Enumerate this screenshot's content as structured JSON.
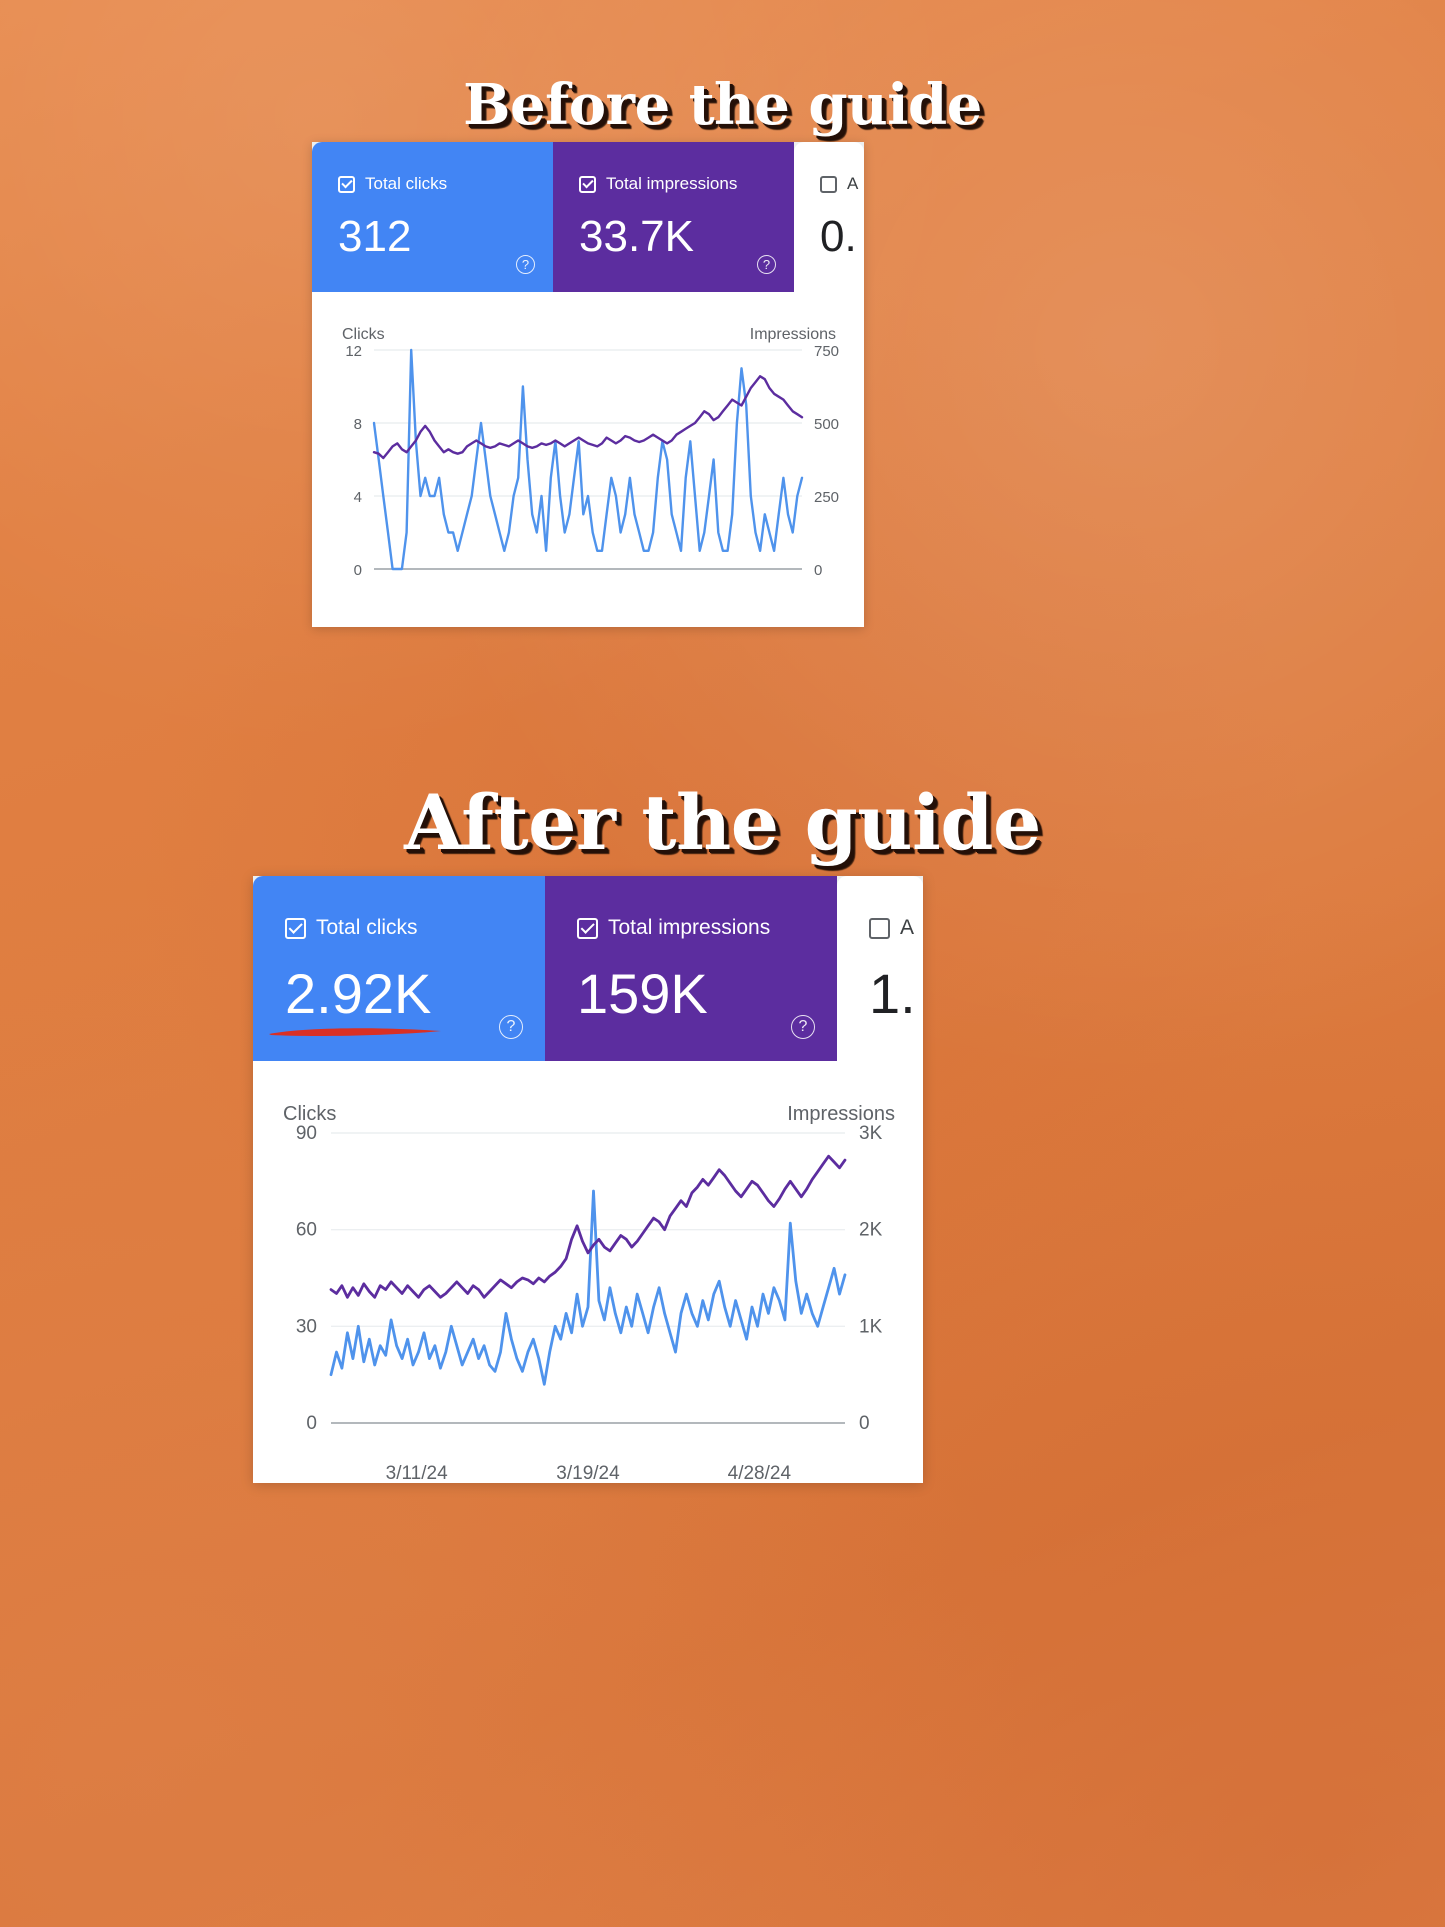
{
  "theme": {
    "background_color": "#e07f42",
    "clicks_color": "#4285f4",
    "impressions_color": "#5c2d9f",
    "clicks_line_color": "#4f93ec",
    "impressions_line_color": "#5c2d9f",
    "annotation_color": "#d93025",
    "title_color": "#ffffff",
    "title_shadow_color": "#241008"
  },
  "sections": {
    "before": {
      "title": "Before the guide",
      "cards": [
        {
          "label": "Total clicks",
          "value": "312",
          "checkbox": "checked",
          "checkbox_icon": "checkbox-checked-icon",
          "help_icon": "help-circle-icon",
          "help_glyph": "?",
          "color": "#4285f4"
        },
        {
          "label": "Total impressions",
          "value": "33.7K",
          "checkbox": "checked",
          "checkbox_icon": "checkbox-checked-icon",
          "help_icon": "help-circle-icon",
          "help_glyph": "?",
          "color": "#5c2d9f"
        },
        {
          "label": "A",
          "value": "0.",
          "checkbox": "unchecked",
          "checkbox_icon": "checkbox-unchecked-icon",
          "help_icon": "",
          "help_glyph": "",
          "color": "#ffffff"
        }
      ]
    },
    "after": {
      "title": "After the guide",
      "annotation": "red-underline-2-92K",
      "cards": [
        {
          "label": "Total clicks",
          "value": "2.92K",
          "checkbox": "checked",
          "checkbox_icon": "checkbox-checked-icon",
          "help_icon": "help-circle-icon",
          "help_glyph": "?",
          "color": "#4285f4"
        },
        {
          "label": "Total impressions",
          "value": "159K",
          "checkbox": "checked",
          "checkbox_icon": "checkbox-checked-icon",
          "help_icon": "help-circle-icon",
          "help_glyph": "?",
          "color": "#5c2d9f"
        },
        {
          "label": "A",
          "value": "1.",
          "checkbox": "unchecked",
          "checkbox_icon": "checkbox-unchecked-icon",
          "help_icon": "",
          "help_glyph": "",
          "color": "#ffffff"
        }
      ]
    }
  },
  "chart_data": [
    {
      "id": "before-chart",
      "type": "line",
      "title": "",
      "xlabel": "",
      "grid": true,
      "legend_position": "axis-titles",
      "axes": {
        "left": {
          "label": "Clicks",
          "ticks": [
            "0",
            "4",
            "8",
            "12"
          ],
          "range": [
            0,
            12
          ]
        },
        "right": {
          "label": "Impressions",
          "ticks": [
            "0",
            "250",
            "500",
            "750"
          ],
          "range": [
            0,
            750
          ]
        }
      },
      "x_tick_labels": [],
      "series": [
        {
          "name": "Clicks",
          "axis": "left",
          "color": "#4f93ec",
          "values": [
            8,
            6,
            4,
            2,
            0,
            0,
            0,
            2,
            12,
            7,
            4,
            5,
            4,
            4,
            5,
            3,
            2,
            2,
            1,
            2,
            3,
            4,
            6,
            8,
            6,
            4,
            3,
            2,
            1,
            2,
            4,
            5,
            10,
            6,
            3,
            2,
            4,
            1,
            5,
            7,
            4,
            2,
            3,
            5,
            7,
            3,
            4,
            2,
            1,
            1,
            3,
            5,
            4,
            2,
            3,
            5,
            3,
            2,
            1,
            1,
            2,
            5,
            7,
            6,
            3,
            2,
            1,
            5,
            7,
            4,
            1,
            2,
            4,
            6,
            2,
            1,
            1,
            3,
            8,
            11,
            9,
            4,
            2,
            1,
            3,
            2,
            1,
            3,
            5,
            3,
            2,
            4,
            5
          ]
        },
        {
          "name": "Impressions",
          "axis": "right",
          "color": "#5c2d9f",
          "values": [
            400,
            395,
            380,
            400,
            420,
            430,
            410,
            400,
            420,
            440,
            470,
            490,
            470,
            440,
            420,
            400,
            410,
            400,
            395,
            400,
            420,
            430,
            440,
            430,
            420,
            415,
            420,
            430,
            425,
            420,
            430,
            440,
            430,
            420,
            415,
            420,
            430,
            425,
            430,
            440,
            430,
            420,
            430,
            440,
            450,
            440,
            430,
            425,
            420,
            430,
            450,
            440,
            430,
            440,
            455,
            450,
            440,
            435,
            440,
            450,
            460,
            450,
            440,
            430,
            440,
            460,
            470,
            480,
            490,
            500,
            520,
            540,
            530,
            510,
            520,
            540,
            560,
            580,
            570,
            560,
            590,
            620,
            640,
            660,
            650,
            620,
            600,
            590,
            580,
            560,
            540,
            530,
            520
          ]
        }
      ]
    },
    {
      "id": "after-chart",
      "type": "line",
      "title": "",
      "xlabel": "",
      "grid": true,
      "legend_position": "axis-titles",
      "axes": {
        "left": {
          "label": "Clicks",
          "ticks": [
            "0",
            "30",
            "60",
            "90"
          ],
          "range": [
            0,
            90
          ]
        },
        "right": {
          "label": "Impressions",
          "ticks": [
            "0",
            "1K",
            "2K",
            "3K"
          ],
          "range": [
            0,
            3000
          ]
        }
      },
      "x_tick_labels": [
        "3/11/24",
        "3/19/24",
        "4/28/24"
      ],
      "series": [
        {
          "name": "Clicks",
          "axis": "left",
          "color": "#4f93ec",
          "values": [
            15,
            22,
            17,
            28,
            20,
            30,
            19,
            26,
            18,
            24,
            21,
            32,
            24,
            20,
            26,
            18,
            22,
            28,
            20,
            24,
            17,
            22,
            30,
            24,
            18,
            22,
            26,
            20,
            24,
            18,
            16,
            22,
            34,
            26,
            20,
            16,
            22,
            26,
            20,
            12,
            22,
            30,
            26,
            34,
            28,
            40,
            30,
            36,
            72,
            38,
            32,
            42,
            34,
            28,
            36,
            30,
            40,
            34,
            28,
            36,
            42,
            34,
            28,
            22,
            34,
            40,
            34,
            30,
            38,
            32,
            40,
            44,
            36,
            30,
            38,
            32,
            26,
            36,
            30,
            40,
            34,
            42,
            38,
            32,
            62,
            44,
            34,
            40,
            34,
            30,
            36,
            42,
            48,
            40,
            46
          ]
        },
        {
          "name": "Impressions",
          "axis": "right",
          "color": "#5c2d9f",
          "values": [
            1380,
            1340,
            1420,
            1300,
            1400,
            1320,
            1440,
            1360,
            1300,
            1420,
            1380,
            1460,
            1400,
            1340,
            1420,
            1360,
            1300,
            1380,
            1420,
            1360,
            1300,
            1340,
            1400,
            1460,
            1400,
            1340,
            1420,
            1380,
            1300,
            1360,
            1420,
            1480,
            1440,
            1400,
            1460,
            1500,
            1480,
            1440,
            1500,
            1460,
            1520,
            1560,
            1620,
            1700,
            1900,
            2040,
            1880,
            1760,
            1840,
            1900,
            1820,
            1780,
            1860,
            1940,
            1900,
            1820,
            1880,
            1960,
            2040,
            2120,
            2080,
            2000,
            2140,
            2220,
            2300,
            2240,
            2380,
            2440,
            2520,
            2460,
            2540,
            2620,
            2560,
            2480,
            2400,
            2340,
            2420,
            2500,
            2460,
            2380,
            2300,
            2240,
            2320,
            2420,
            2500,
            2420,
            2340,
            2420,
            2520,
            2600,
            2680,
            2760,
            2700,
            2640,
            2720
          ]
        }
      ]
    }
  ]
}
